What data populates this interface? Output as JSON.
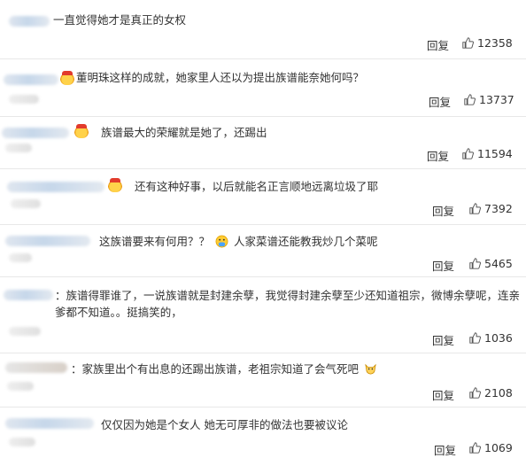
{
  "comments": [
    {
      "text": "一直觉得她才是真正的女权",
      "reply": "回复",
      "likes": "12358"
    },
    {
      "text": "董明珠这样的成就，她家里人还以为提出族谱能奈她何吗？",
      "reply": "回复",
      "likes": "13737"
    },
    {
      "text": "族谱最大的荣耀就是她了，还踢出",
      "reply": "回复",
      "likes": "11594"
    },
    {
      "text": "还有这种好事，以后就能名正言顺地远离垃圾了耶",
      "reply": "回复",
      "likes": "7392"
    },
    {
      "text_a": "这族谱要来有何用？？",
      "emoji": "hand-cover-mouth-emoji",
      "text_b": "人家菜谱还能教我炒几个菜呢",
      "reply": "回复",
      "likes": "5465"
    },
    {
      "text": "：族谱得罪谁了，一说族谱就是封建余孽，我觉得封建余孽至少还知道祖宗，微博余孽呢，连亲爹都不知道。。挺搞笑的，",
      "reply": "回复",
      "likes": "1036"
    },
    {
      "text": "：家族里出个有出息的还踢出族谱，老祖宗知道了会气死吧",
      "emoji": "fox-emoji",
      "reply": "回复",
      "likes": "2108"
    },
    {
      "text": "仅仅因为她是个女人 她无可厚非的做法也要被议论",
      "reply": "回复",
      "likes": "1069"
    }
  ],
  "icons": {
    "like": "thumbs-up-icon",
    "badge": "crown-heart-badge-icon"
  },
  "colors": {
    "text": "#333333",
    "separator": "#e8e8e8",
    "icon": "#555555"
  }
}
